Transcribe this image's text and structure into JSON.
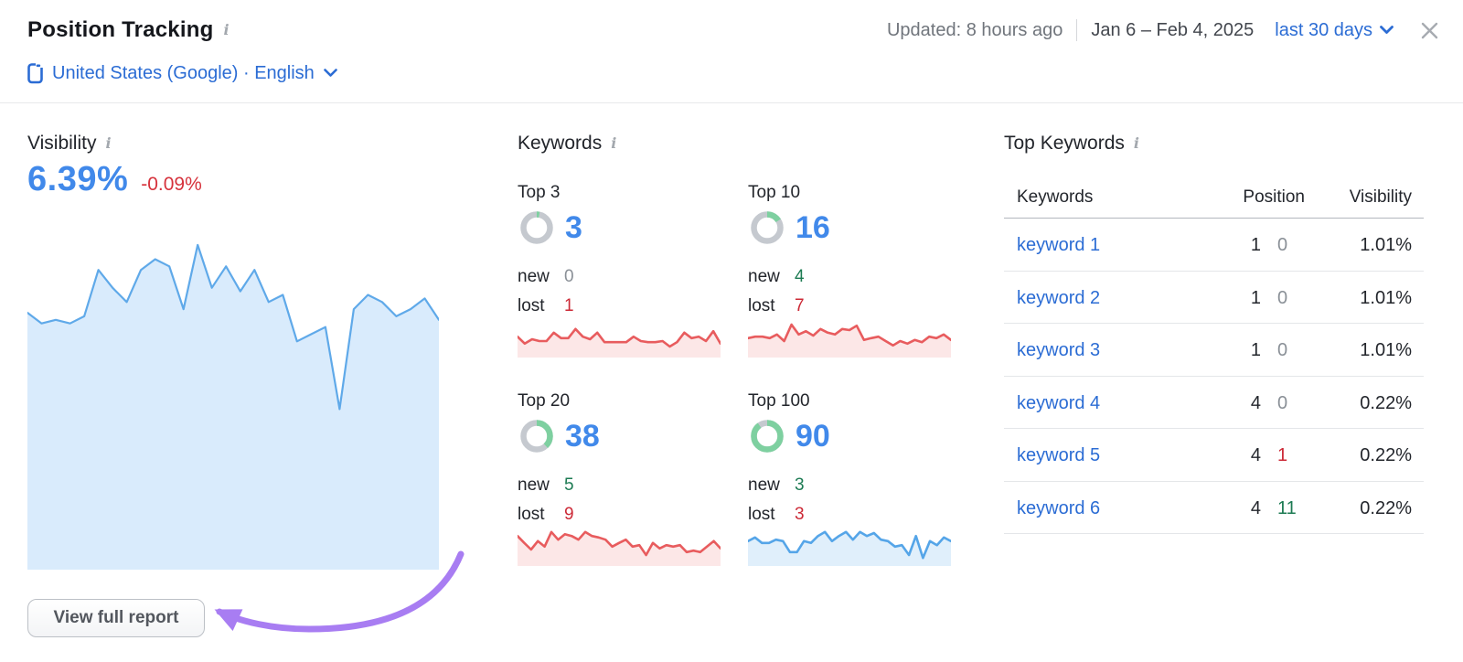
{
  "header": {
    "title": "Position Tracking",
    "updated_label": "Updated: 8 hours ago",
    "date_range": "Jan 6 – Feb 4, 2025",
    "period_selector": "last 30 days",
    "location": "United States (Google) · English"
  },
  "visibility": {
    "title": "Visibility",
    "value": "6.39%",
    "change": "-0.09%",
    "button_label": "View full report"
  },
  "keywords": {
    "title": "Keywords",
    "cards": [
      {
        "label": "Top 3",
        "count": "3",
        "new_label": "new",
        "new_value": "0",
        "new_class": "gray",
        "lost_label": "lost",
        "lost_value": "1",
        "lost_class": "red"
      },
      {
        "label": "Top 10",
        "count": "16",
        "new_label": "new",
        "new_value": "4",
        "new_class": "green",
        "lost_label": "lost",
        "lost_value": "7",
        "lost_class": "red"
      },
      {
        "label": "Top 20",
        "count": "38",
        "new_label": "new",
        "new_value": "5",
        "new_class": "green",
        "lost_label": "lost",
        "lost_value": "9",
        "lost_class": "red"
      },
      {
        "label": "Top 100",
        "count": "90",
        "new_label": "new",
        "new_value": "3",
        "new_class": "green",
        "lost_label": "lost",
        "lost_value": "3",
        "lost_class": "red"
      }
    ]
  },
  "top_keywords": {
    "title": "Top Keywords",
    "columns": [
      "Keywords",
      "Position",
      "Visibility"
    ],
    "rows": [
      {
        "keyword": "keyword 1",
        "position": "1",
        "diff": "0",
        "diff_class": "gray",
        "visibility": "1.01%"
      },
      {
        "keyword": "keyword 2",
        "position": "1",
        "diff": "0",
        "diff_class": "gray",
        "visibility": "1.01%"
      },
      {
        "keyword": "keyword 3",
        "position": "1",
        "diff": "0",
        "diff_class": "gray",
        "visibility": "1.01%"
      },
      {
        "keyword": "keyword 4",
        "position": "4",
        "diff": "0",
        "diff_class": "gray",
        "visibility": "0.22%"
      },
      {
        "keyword": "keyword 5",
        "position": "4",
        "diff": "1",
        "diff_class": "red",
        "visibility": "0.22%"
      },
      {
        "keyword": "keyword 6",
        "position": "4",
        "diff": "11",
        "diff_class": "green",
        "visibility": "0.22%"
      }
    ]
  },
  "chart_data": {
    "visibility_trend": {
      "type": "area",
      "title": "Visibility 6.39% (-0.09%)",
      "x_range": "Jan 6 – Feb 4, 2025",
      "ylabel": "relative visibility (0–1 of plot height)",
      "grid": false,
      "values": [
        0.72,
        0.69,
        0.7,
        0.69,
        0.71,
        0.84,
        0.79,
        0.75,
        0.84,
        0.87,
        0.85,
        0.73,
        0.91,
        0.79,
        0.85,
        0.78,
        0.84,
        0.75,
        0.77,
        0.64,
        0.66,
        0.68,
        0.45,
        0.73,
        0.77,
        0.75,
        0.71,
        0.73,
        0.76,
        0.7
      ]
    },
    "keyword_donuts": {
      "type": "pie",
      "items": [
        {
          "label": "Top 3",
          "count": 3,
          "percent": 3
        },
        {
          "label": "Top 10",
          "count": 16,
          "percent": 16
        },
        {
          "label": "Top 20",
          "count": 38,
          "percent": 38
        },
        {
          "label": "Top 100",
          "count": 90,
          "percent": 90
        }
      ]
    },
    "sparklines": {
      "type": "area",
      "x_range": "Jan 6 – Feb 4, 2025",
      "series": [
        {
          "name": "Top 3",
          "color": "red",
          "values": [
            0.57,
            0.38,
            0.5,
            0.45,
            0.45,
            0.68,
            0.53,
            0.53,
            0.78,
            0.57,
            0.5,
            0.68,
            0.42,
            0.42,
            0.42,
            0.42,
            0.57,
            0.45,
            0.42,
            0.42,
            0.45,
            0.3,
            0.42,
            0.68,
            0.53,
            0.57,
            0.45,
            0.72,
            0.38
          ]
        },
        {
          "name": "Top 10",
          "color": "red",
          "values": [
            0.53,
            0.57,
            0.57,
            0.53,
            0.63,
            0.45,
            0.9,
            0.63,
            0.72,
            0.6,
            0.78,
            0.68,
            0.63,
            0.78,
            0.75,
            0.87,
            0.48,
            0.53,
            0.57,
            0.45,
            0.33,
            0.45,
            0.38,
            0.48,
            0.42,
            0.57,
            0.53,
            0.63,
            0.48
          ]
        },
        {
          "name": "Top 20",
          "color": "red",
          "values": [
            0.82,
            0.63,
            0.45,
            0.68,
            0.53,
            0.93,
            0.72,
            0.87,
            0.82,
            0.72,
            0.93,
            0.82,
            0.78,
            0.72,
            0.53,
            0.63,
            0.72,
            0.53,
            0.57,
            0.3,
            0.63,
            0.48,
            0.57,
            0.53,
            0.57,
            0.38,
            0.42,
            0.38,
            0.53,
            0.68,
            0.48
          ]
        },
        {
          "name": "Top 100",
          "color": "blue",
          "values": [
            0.68,
            0.78,
            0.63,
            0.63,
            0.72,
            0.68,
            0.38,
            0.38,
            0.68,
            0.63,
            0.82,
            0.93,
            0.68,
            0.82,
            0.93,
            0.72,
            0.93,
            0.82,
            0.9,
            0.72,
            0.68,
            0.53,
            0.57,
            0.3,
            0.82,
            0.22,
            0.68,
            0.57,
            0.78,
            0.68
          ]
        }
      ]
    }
  },
  "colors": {
    "accent_blue": "#2b6cd4",
    "metric_blue": "#4189ea",
    "negative_red": "#d0282f",
    "positive_green": "#1d7b53",
    "neutral_gray": "#8a9097",
    "area_line": "#5fa9e9",
    "area_fill": "#d9ebfc",
    "spark_red_line": "#e85c5e",
    "spark_red_fill": "rgba(232,92,94,0.15)",
    "spark_blue_line": "#55a5e8",
    "spark_blue_fill": "rgba(85,165,232,0.18)",
    "donut_gray": "#c5c9cf",
    "donut_green": "#7ed0a0",
    "arrow_purple": "#a87df2"
  }
}
